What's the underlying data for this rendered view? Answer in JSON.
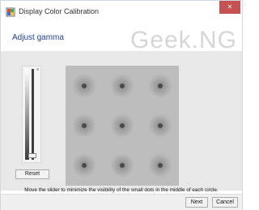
{
  "window": {
    "title": "Display Color Calibration",
    "close_label": "✕",
    "title_icon": "color-calibration-icon"
  },
  "header": {
    "title": "Adjust gamma",
    "watermark": "Geek.NG"
  },
  "slider": {
    "position_fraction": 0.98
  },
  "reset_label": "Reset",
  "gamma_pattern": {
    "rows": 3,
    "cols": 3
  },
  "instruction": "Move the slider to minimize the visibility of the small dots in the middle of each circle.",
  "footer": {
    "next_label": "Next",
    "cancel_label": "Cancel"
  },
  "colors": {
    "close_button": "#c75050",
    "header_title": "#1f3f8f"
  }
}
